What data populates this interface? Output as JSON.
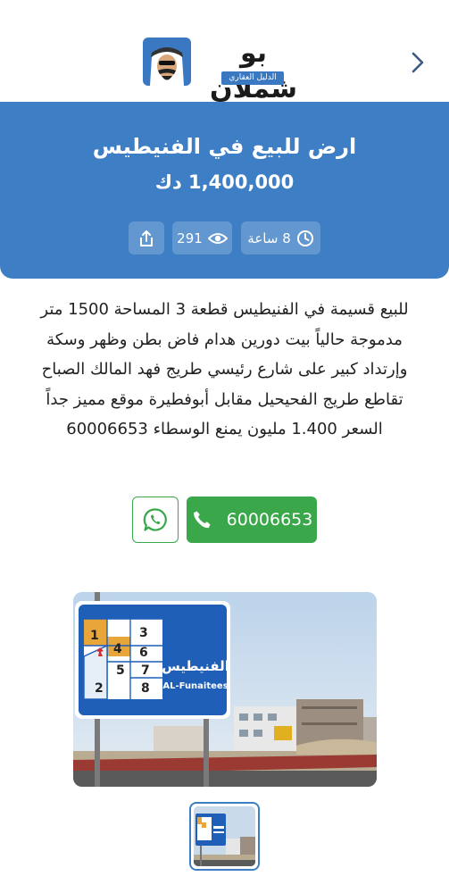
{
  "header": {
    "logo_text": "بو شملان",
    "logo_subtitle": "الدليل العقاري",
    "back_icon": "chevron-right-icon"
  },
  "listing": {
    "title": "ارض للبيع في الفنيطيس",
    "price": "1,400,000 دك",
    "posted_ago": "8 ساعة",
    "views": "291",
    "description": "للبيع قسيمة في الفنيطيس قطعة 3 المساحة 1500 متر مدموجة حالياً بيت دورين هدام فاض بطن وظهر وسكة وإرتداد كبير على شارع رئيسي طريج فهد المالك الصباح تقاطع طريج الفحيحيل مقابل أبوفطيرة موقع مميز جداً السعر 1.400 مليون يمنع الوسطاء 60006653"
  },
  "contact": {
    "phone": "60006653",
    "call_icon": "phone-icon",
    "whatsapp_icon": "whatsapp-icon"
  },
  "photo": {
    "sign_arabic": "الفنيطيس",
    "sign_english": "AL-Funaitees",
    "block_numbers": [
      "1",
      "3",
      "4",
      "6",
      "5",
      "7",
      "2",
      "8"
    ]
  },
  "colors": {
    "primary_blue": "#3d7ec4",
    "whatsapp_green": "#3aa84a"
  }
}
